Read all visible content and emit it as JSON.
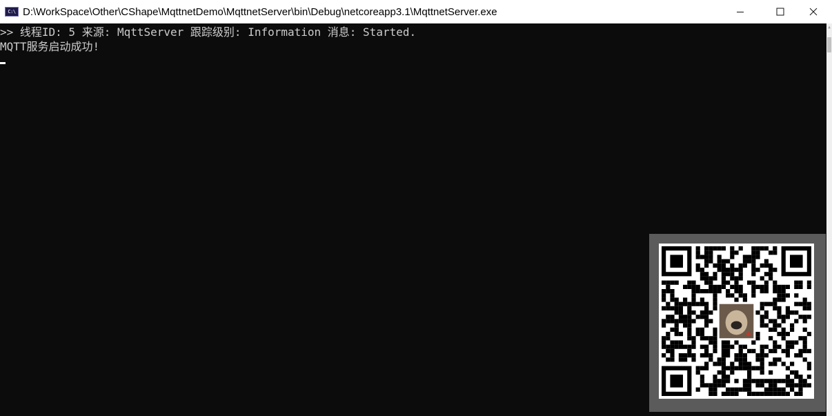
{
  "window": {
    "title": "D:\\WorkSpace\\Other\\CShape\\MqttnetDemo\\MqttnetServer\\bin\\Debug\\netcoreapp3.1\\MqttnetServer.exe",
    "icon_glyph": "C:\\",
    "buttons": {
      "minimize": "—",
      "maximize": "☐",
      "close": "✕"
    }
  },
  "console": {
    "lines": [
      ">> 线程ID: 5 来源: MqttServer 跟踪级别: Information 消息: Started.",
      "MQTT服务启动成功!"
    ],
    "text_color": "#cccccc",
    "background": "#0c0c0c"
  },
  "overlay": {
    "icon": "qr-code-icon"
  }
}
